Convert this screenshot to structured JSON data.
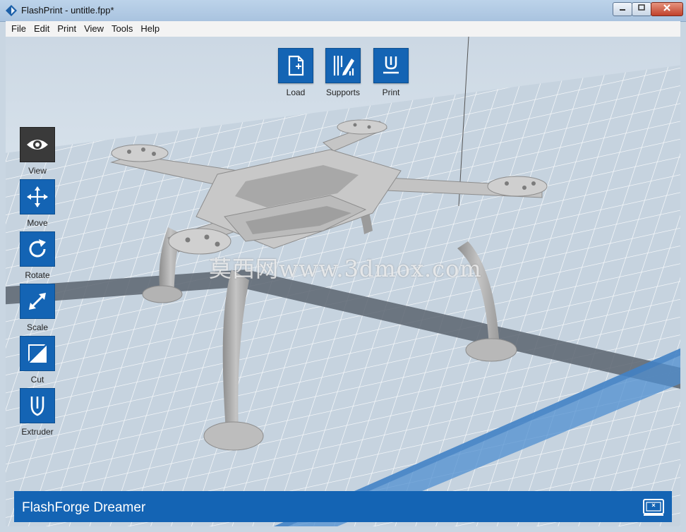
{
  "window": {
    "title": "FlashPrint - untitle.fpp*"
  },
  "menu": {
    "items": [
      "File",
      "Edit",
      "Print",
      "View",
      "Tools",
      "Help"
    ]
  },
  "top_toolbar": {
    "load": "Load",
    "supports": "Supports",
    "print": "Print"
  },
  "side_toolbar": {
    "view": "View",
    "move": "Move",
    "rotate": "Rotate",
    "scale": "Scale",
    "cut": "Cut",
    "extruder": "Extruder"
  },
  "status": {
    "printer_name": "FlashForge Dreamer"
  },
  "watermark": "莫西网www.3dmox.com",
  "colors": {
    "accent": "#1464b4",
    "active_tool": "#3a3a3a",
    "model": "#a9a9a9"
  },
  "icons": [
    "app-logo-icon",
    "minimize-icon",
    "maximize-icon",
    "close-icon",
    "load-file-icon",
    "supports-icon",
    "print-icon",
    "eye-icon",
    "move-arrows-icon",
    "rotate-icon",
    "scale-arrow-icon",
    "cut-icon",
    "extruder-icon",
    "printer-icon"
  ]
}
